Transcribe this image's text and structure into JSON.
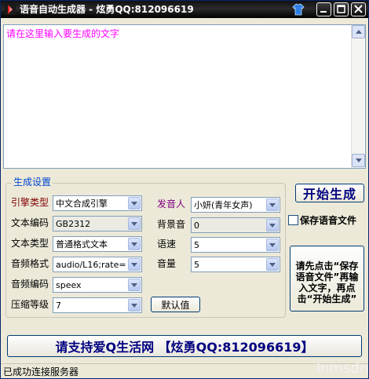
{
  "window": {
    "title": "语音自动生成器 - 炫勇QQ:812096619"
  },
  "editor": {
    "placeholder_text": "请在这里输入要生成的文字"
  },
  "settings": {
    "group_title": "生成设置",
    "engine_type": {
      "label": "引擎类型",
      "value": "中文合成引擎"
    },
    "text_encoding": {
      "label": "文本编码",
      "value": "GB2312"
    },
    "text_type": {
      "label": "文本类型",
      "value": "普通格式文本"
    },
    "audio_format": {
      "label": "音频格式",
      "value": "audio/L16;rate="
    },
    "audio_encoding": {
      "label": "音频编码",
      "value": "speex"
    },
    "compression_level": {
      "label": "压缩等级",
      "value": "7"
    },
    "speaker": {
      "label": "发音人",
      "value": "小妍(青年女声)"
    },
    "background_sound": {
      "label": "背景音",
      "value": "0"
    },
    "speed": {
      "label": "语速",
      "value": "5"
    },
    "volume": {
      "label": "音量",
      "value": "5"
    },
    "default_button": "默认值"
  },
  "actions": {
    "start_button": "开始生成",
    "save_audio_checkbox": {
      "label": "保存语音文件",
      "checked": false
    },
    "hint": "请先点击“保存语音文件”再输入文字，再点击“开始生成”"
  },
  "banner": "请支持爱Q生活网 【炫勇QQ:812096619】",
  "status": {
    "message": "已成功连接服务器",
    "watermark": "lnmsdn"
  }
}
